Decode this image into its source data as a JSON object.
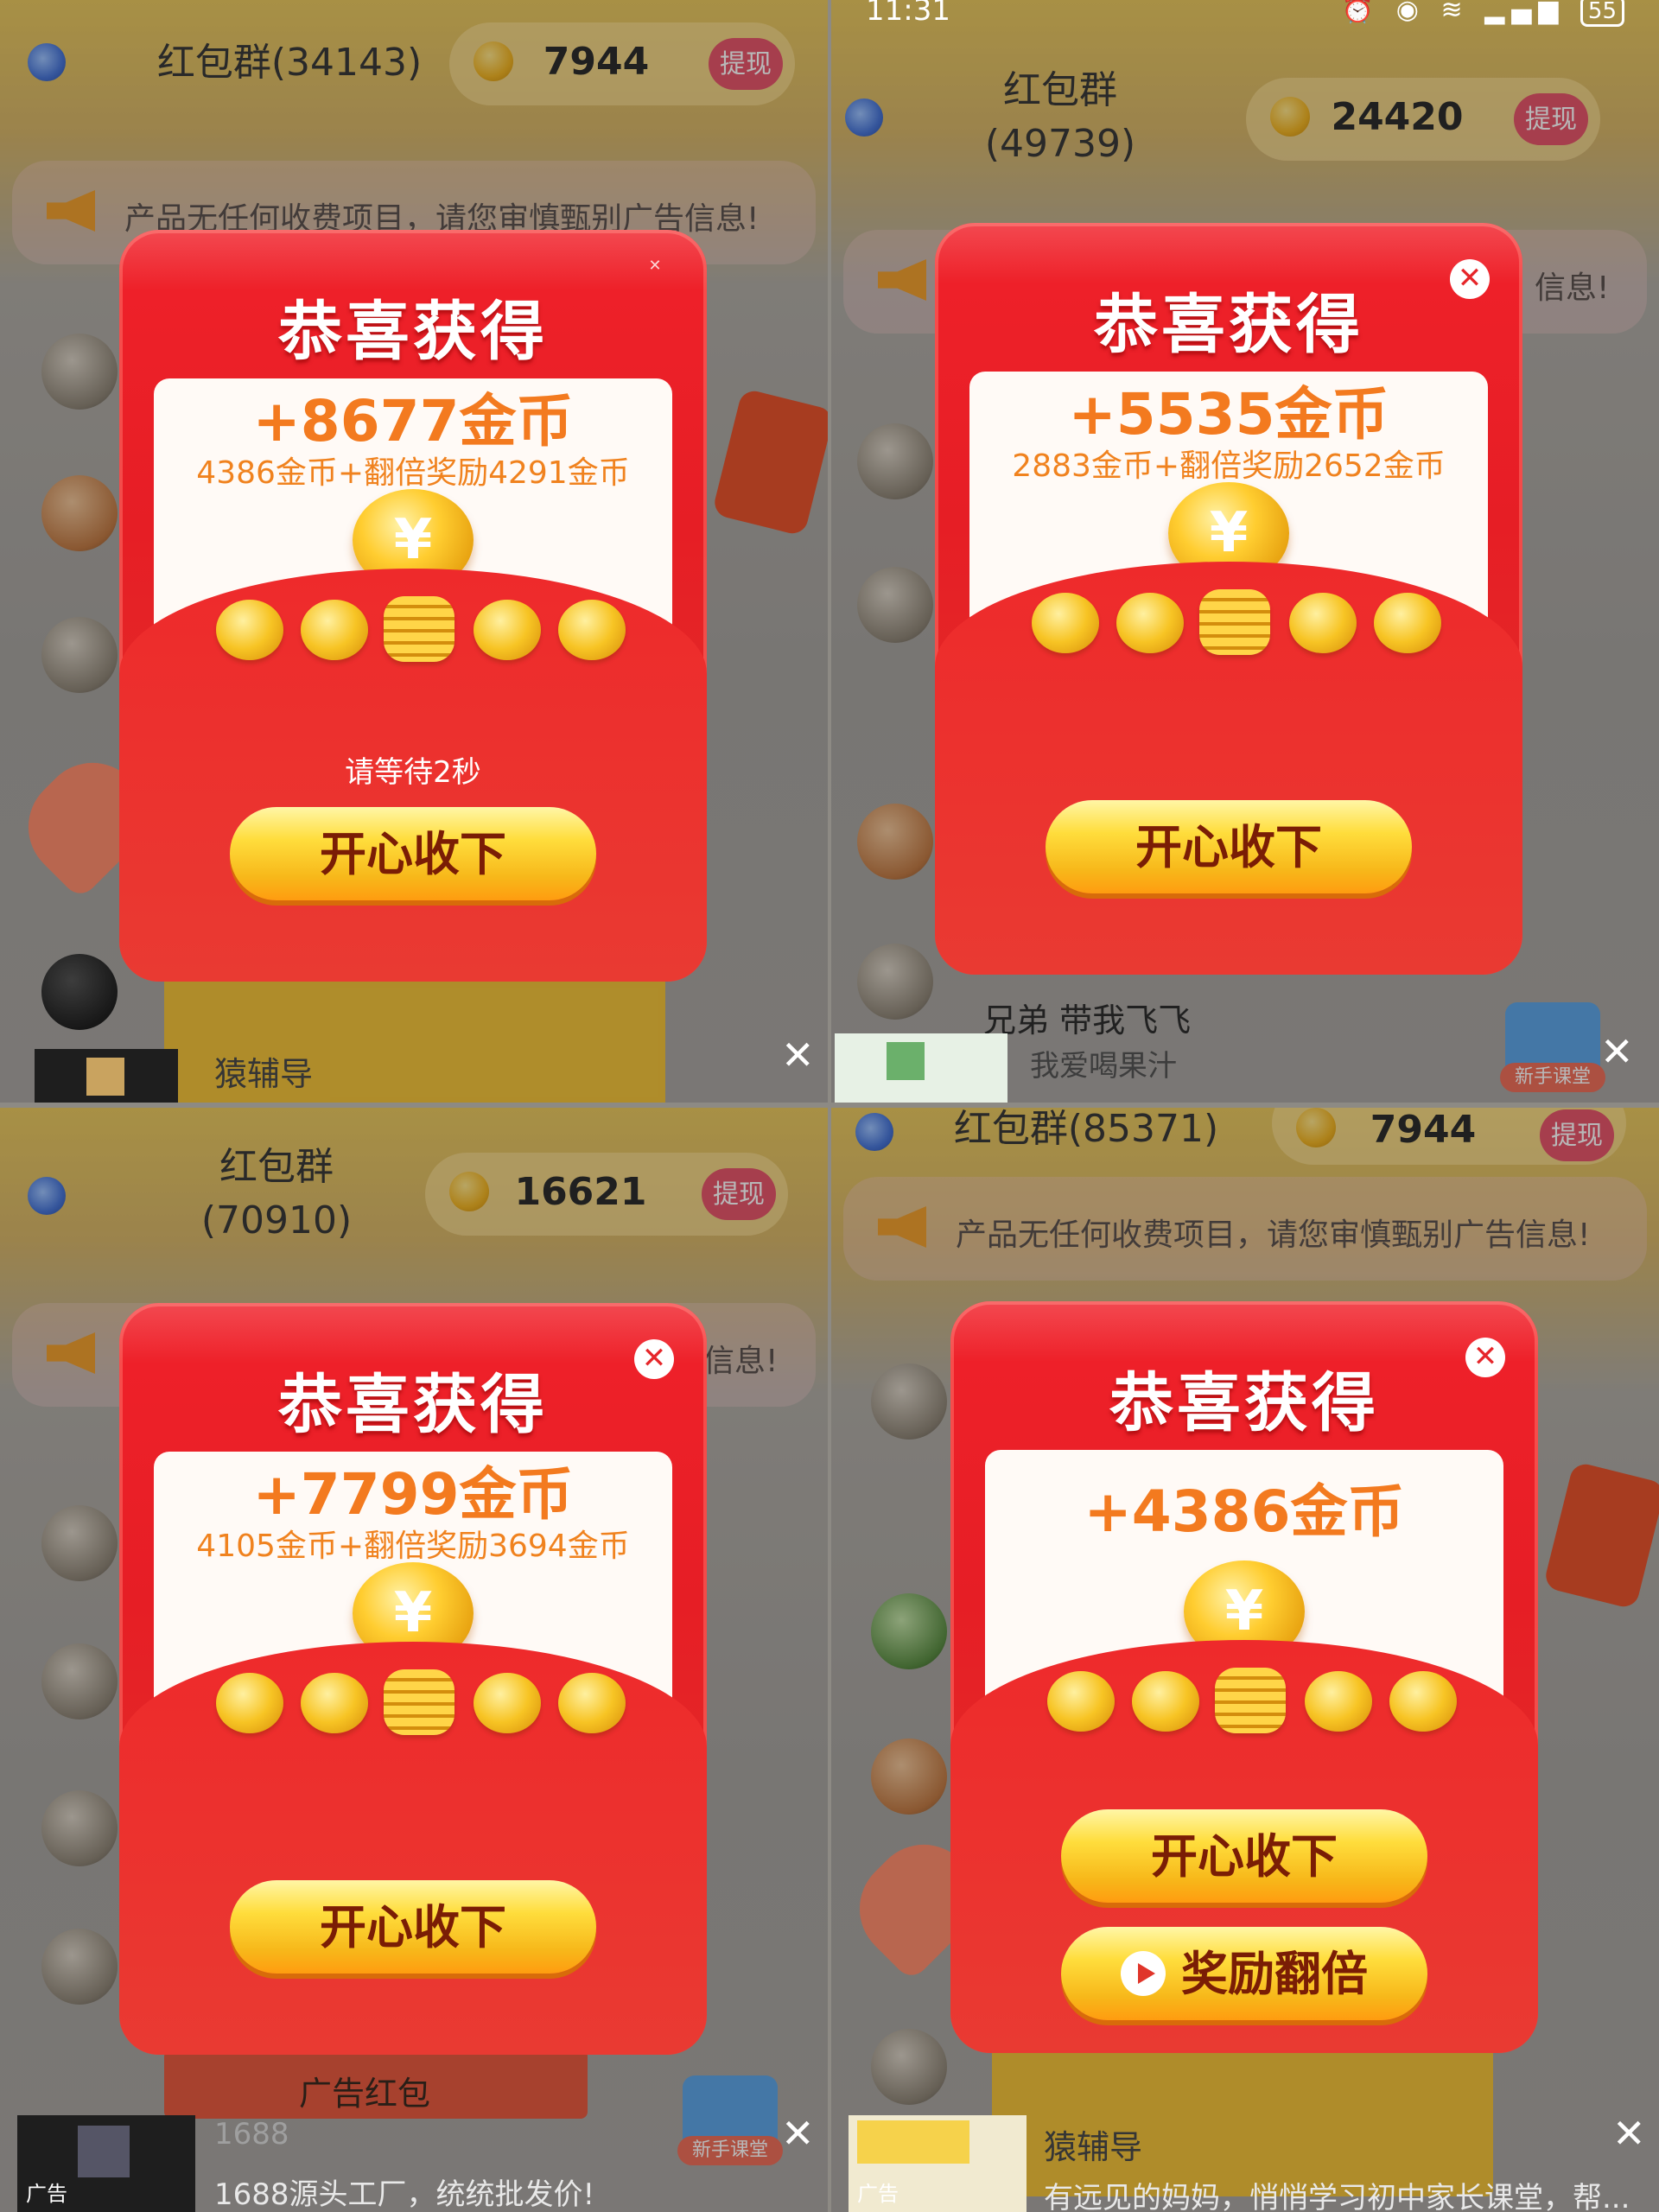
{
  "panels": [
    {
      "group_title": "红包群(34143)",
      "balance": "7944",
      "withdraw_label": "提现",
      "notice": "产品无任何收费项目，请您审慎甄别广告信息!",
      "dialog": {
        "heading": "恭喜获得",
        "amount": "+8677金币",
        "breakdown": "4386金币+翻倍奖励4291金币",
        "wait_text": "请等待2秒",
        "button": "开心收下"
      },
      "chat_name": "猿辅导",
      "ad_close": "✕"
    },
    {
      "status_time": "11:31",
      "battery": "55",
      "group_title_line1": "红包群",
      "group_title_line2": "(49739)",
      "balance": "24420",
      "withdraw_label": "提现",
      "notice_tail": "信息!",
      "dialog": {
        "heading": "恭喜获得",
        "amount": "+5535金币",
        "breakdown": "2883金币+翻倍奖励2652金币",
        "button": "开心收下",
        "close": "✕"
      },
      "chat_name": "兄弟 带我飞飞",
      "chat_msg": "我爱喝果汁",
      "newbie_label": "新手课堂",
      "ad_close": "✕"
    },
    {
      "group_title_line1": "红包群",
      "group_title_line2": "(70910)",
      "balance": "16621",
      "withdraw_label": "提现",
      "notice_tail": "信息!",
      "dialog": {
        "heading": "恭喜获得",
        "amount": "+7799金币",
        "breakdown": "4105金币+翻倍奖励3694金币",
        "button": "开心收下",
        "close": "✕"
      },
      "ad_title": "广告红包",
      "ad_sender": "1688",
      "ad_text": "1688源头工厂，统统批发价!",
      "ad_label": "广告",
      "newbie_label": "新手课堂",
      "ad_close": "✕"
    },
    {
      "group_title": "红包群(85371)",
      "balance": "7944",
      "withdraw_label": "提现",
      "notice": "产品无任何收费项目，请您审慎甄别广告信息!",
      "dialog": {
        "heading": "恭喜获得",
        "amount": "+4386金币",
        "button": "开心收下",
        "double_button": "奖励翻倍",
        "close": "✕"
      },
      "chat_name": "猿辅导",
      "ad_text": "有远见的妈妈，悄悄学习初中家长课堂，帮...",
      "ad_label": "广告",
      "ad_close": "✕"
    }
  ]
}
